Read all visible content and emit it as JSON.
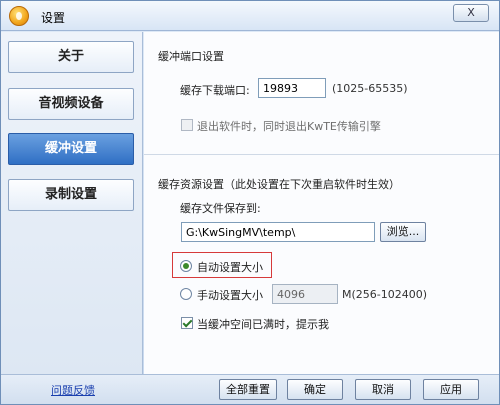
{
  "window": {
    "title": "设置",
    "close_label": "X"
  },
  "sidebar": {
    "items": [
      {
        "label": "关于"
      },
      {
        "label": "音视频设备"
      },
      {
        "label": "缓冲设置",
        "active": true
      },
      {
        "label": "录制设置"
      }
    ]
  },
  "cache_port": {
    "section_title": "缓冲端口设置",
    "port_label": "缓存下载端口:",
    "port_value": "19893",
    "port_range": "(1025-65535)",
    "exit_checkbox_label": "退出软件时，同时退出KwTE传输引擎",
    "exit_checked": false
  },
  "cache_resource": {
    "section_title": "缓存资源设置（此处设置在下次重启软件时生效）",
    "path_label": "缓存文件保存到:",
    "path_value": "G:\\KwSingMV\\temp\\",
    "browse_label": "浏览...",
    "auto_size_label": "自动设置大小",
    "manual_size_label": "手动设置大小",
    "manual_size_value": "4096",
    "manual_size_range": "M(256-102400)",
    "notify_label": "当缓冲空间已满时，提示我",
    "notify_checked": true
  },
  "footer": {
    "feedback_label": "问题反馈",
    "reset_label": "全部重置",
    "ok_label": "确定",
    "cancel_label": "取消",
    "apply_label": "应用"
  },
  "colors": {
    "accent": "#2f6fc4",
    "highlight": "#d63a3a"
  }
}
